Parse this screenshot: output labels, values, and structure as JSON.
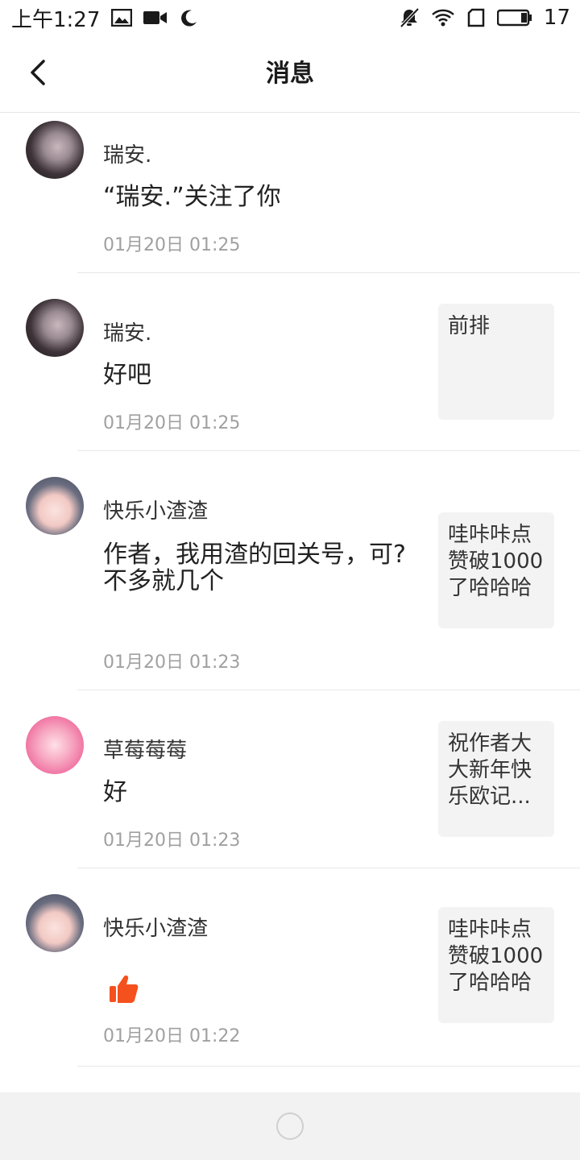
{
  "status_bar": {
    "time": "上午1:27",
    "battery": "17",
    "icons": [
      "image-icon",
      "video-icon",
      "moon-icon",
      "mute-icon",
      "wifi-icon",
      "sim-icon",
      "battery-icon"
    ]
  },
  "header": {
    "title": "消息",
    "back_icon": "chevron-left-icon"
  },
  "messages": [
    {
      "user": "瑞安.",
      "content": "“瑞安.”关注了你",
      "time": "01月20日 01:25",
      "thumb": "",
      "avatar": "dark-hair"
    },
    {
      "user": "瑞安.",
      "content": "好吧",
      "time": "01月20日 01:25",
      "thumb": "前排",
      "avatar": "dark-hair"
    },
    {
      "user": "快乐小渣渣",
      "content": "作者，我用渣的回关号，可?\n不多就几个",
      "time": "01月20日 01:23",
      "thumb": "哇咔咔点赞破1000了哈哈哈",
      "avatar": "anime-girl"
    },
    {
      "user": "草莓莓莓",
      "content": "好",
      "time": "01月20日 01:23",
      "thumb": "祝作者大大新年快乐欧记...",
      "avatar": "pink-anime"
    },
    {
      "user": "快乐小渣渣",
      "content": "",
      "time": "01月20日 01:22",
      "thumb": "哇咔咔点赞破1000了哈哈哈",
      "avatar": "anime-girl",
      "content_icon": "thumbs-up-icon"
    }
  ],
  "colors": {
    "thumbs_up": "#f4511e",
    "time_text": "#a0a0a0",
    "thumb_bg": "#f3f3f3"
  }
}
